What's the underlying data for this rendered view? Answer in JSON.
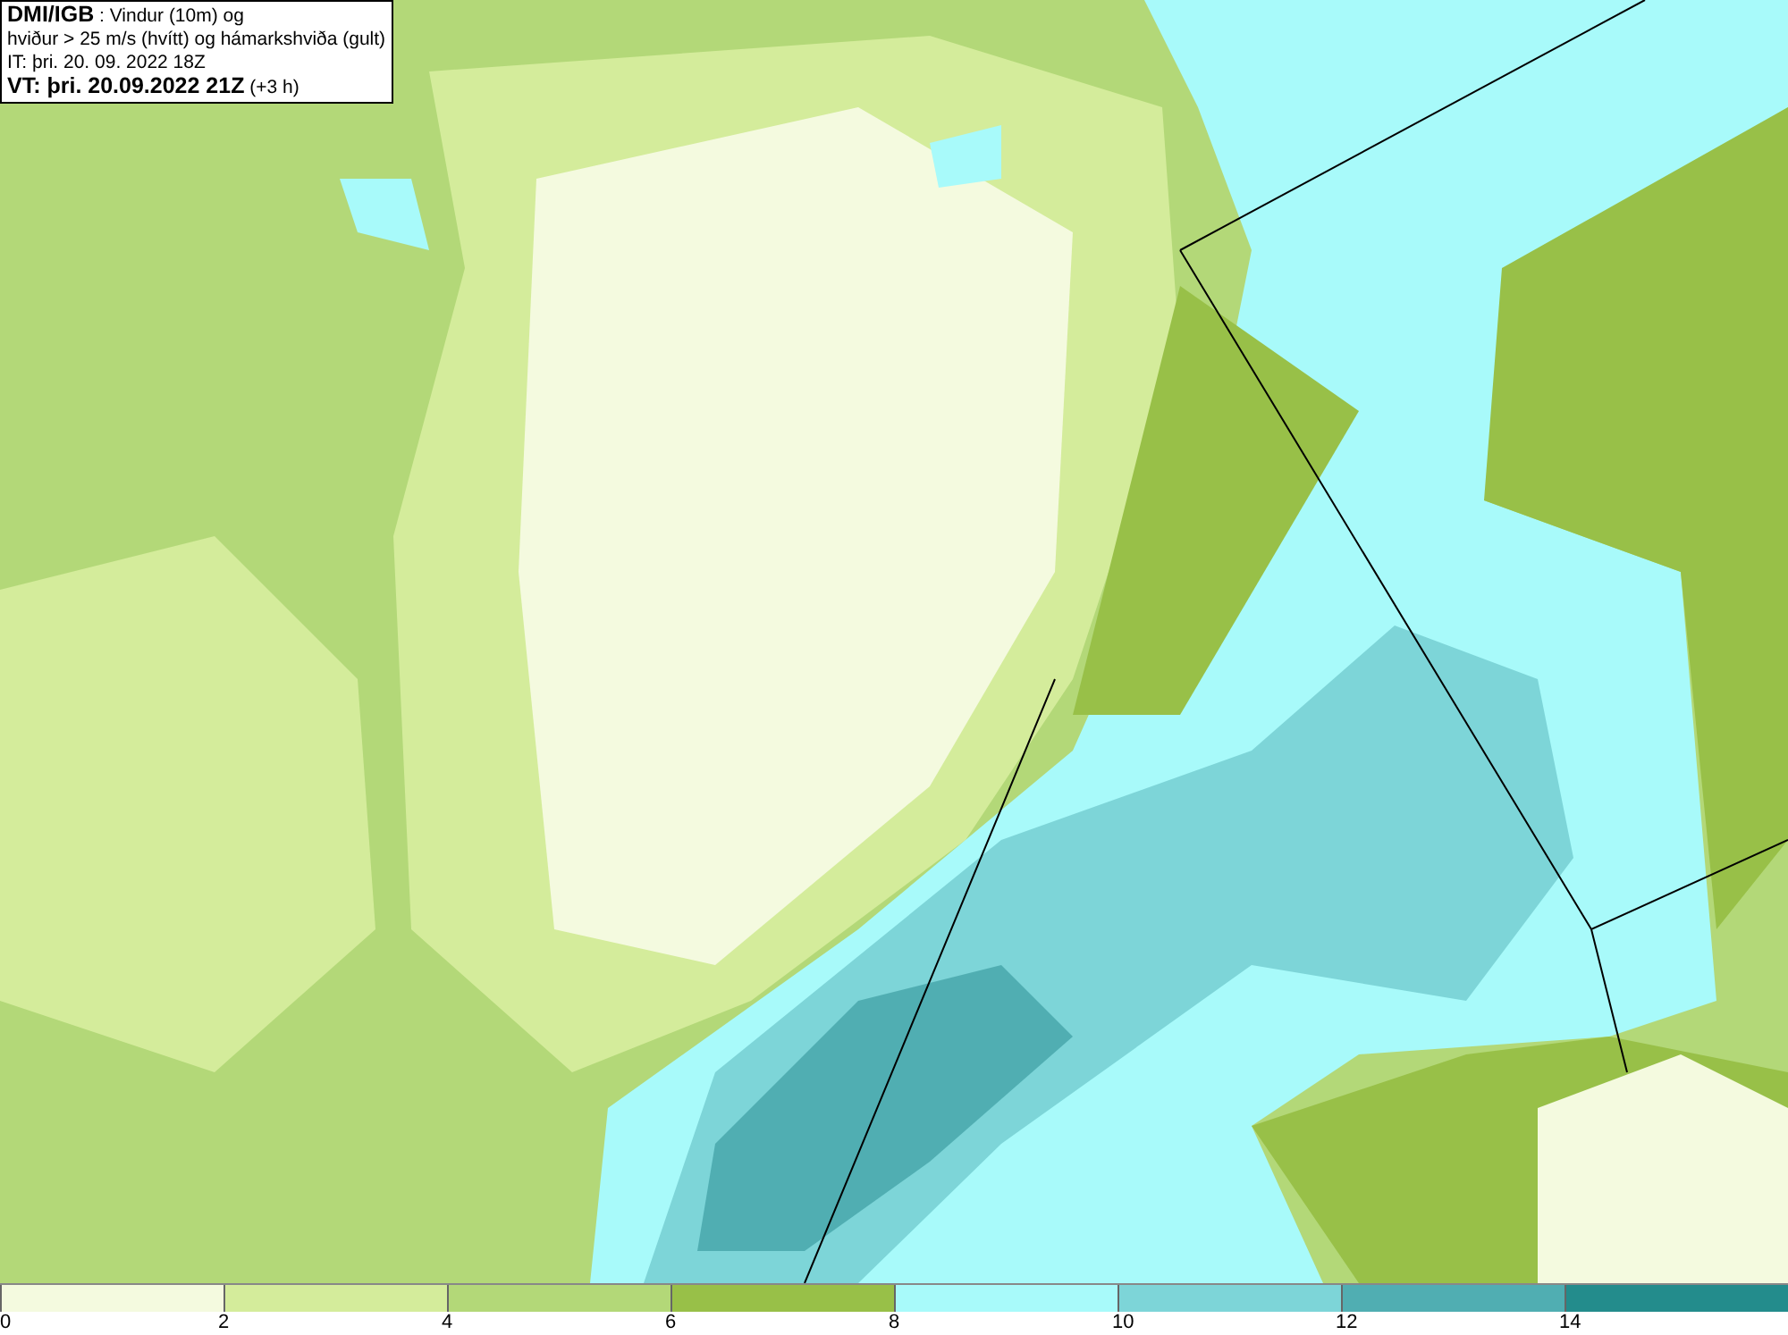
{
  "header": {
    "lines": [
      "**DMI/IGB** : Vindur (10m) og",
      "hviður > 25 m/s (hvítt) og hámarkshviða (gult)",
      "IT: þri. 20. 09. 2022 18Z",
      "**VT: þri. 20.09.2022 21Z** (+3 h)"
    ]
  },
  "legend": {
    "bins": [
      {
        "label": "0",
        "color": "#f4fadf"
      },
      {
        "label": "2",
        "color": "#d4ec9b"
      },
      {
        "label": "4",
        "color": "#b3d878"
      },
      {
        "label": "6",
        "color": "#98c048"
      },
      {
        "label": "8",
        "color": "#a8fafa"
      },
      {
        "label": "10",
        "color": "#7dd5d8"
      },
      {
        "label": "12",
        "color": "#50aeb2"
      },
      {
        "label": "14",
        "color": "#238c8c"
      }
    ]
  }
}
